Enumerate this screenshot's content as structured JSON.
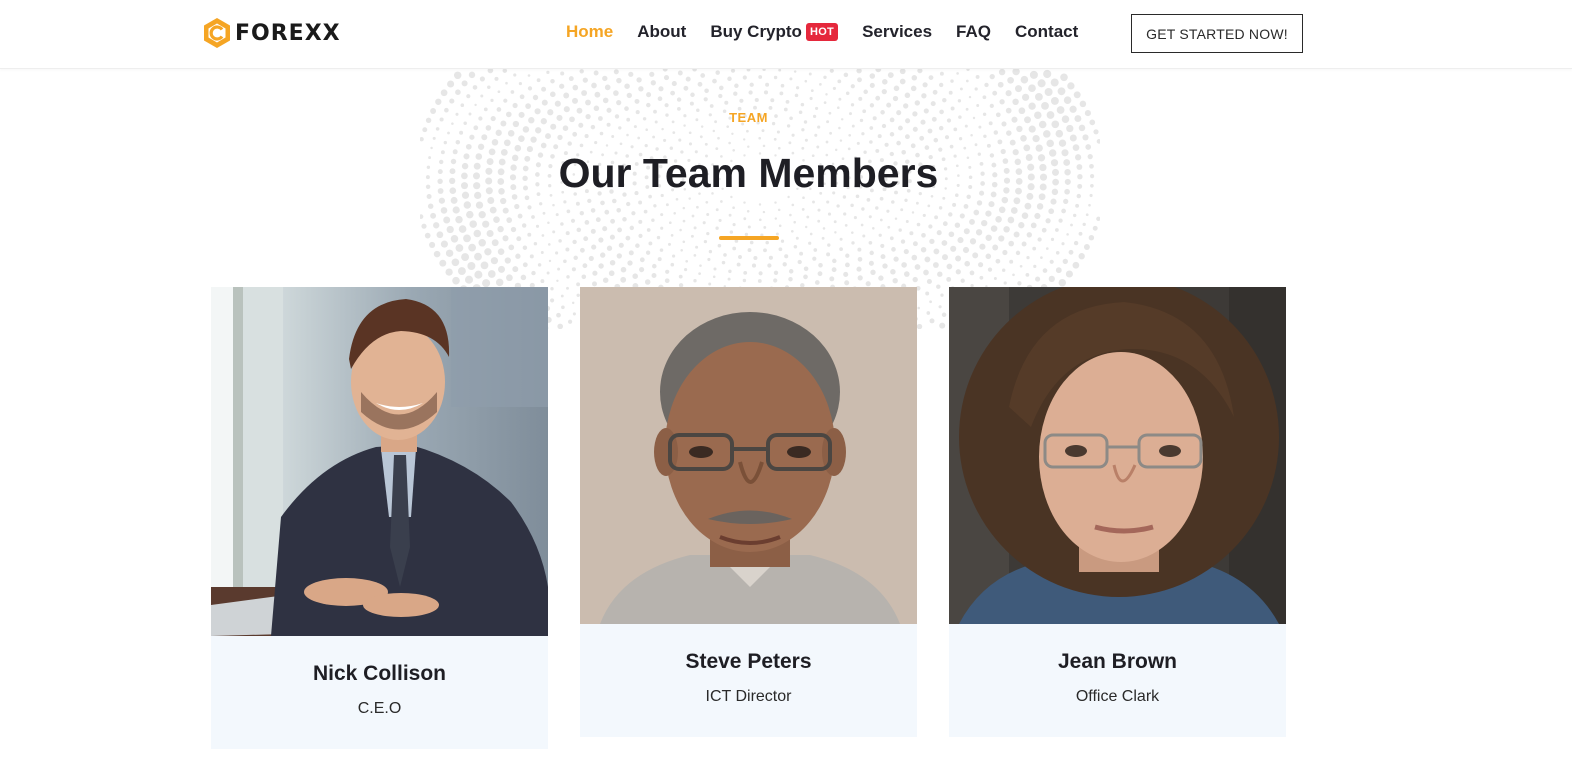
{
  "brand": {
    "name": "FOREXX",
    "accent": "#f5a524",
    "dark": "#1e1e24"
  },
  "nav": {
    "items": [
      {
        "label": "Home",
        "active": true
      },
      {
        "label": "About",
        "active": false
      },
      {
        "label": "Buy Crypto",
        "active": false,
        "badge": "HOT"
      },
      {
        "label": "Services",
        "active": false
      },
      {
        "label": "FAQ",
        "active": false
      },
      {
        "label": "Contact",
        "active": false
      }
    ],
    "badge_color": "#e5283c",
    "cta_label": "GET STARTED NOW!"
  },
  "section": {
    "eyebrow": "TEAM",
    "title": "Our Team Members",
    "card_background": "#f3f8fd"
  },
  "team": [
    {
      "name": "Nick Collison",
      "role": "C.E.O",
      "photo": "photo of smiling man in dark suit at desk with laptop"
    },
    {
      "name": "Steve Peters",
      "role": "ICT Director",
      "photo": "portrait of older man with glasses and mustache"
    },
    {
      "name": "Jean Brown",
      "role": "Office Clark",
      "photo": "portrait of woman with curly brown hair and glasses"
    }
  ]
}
